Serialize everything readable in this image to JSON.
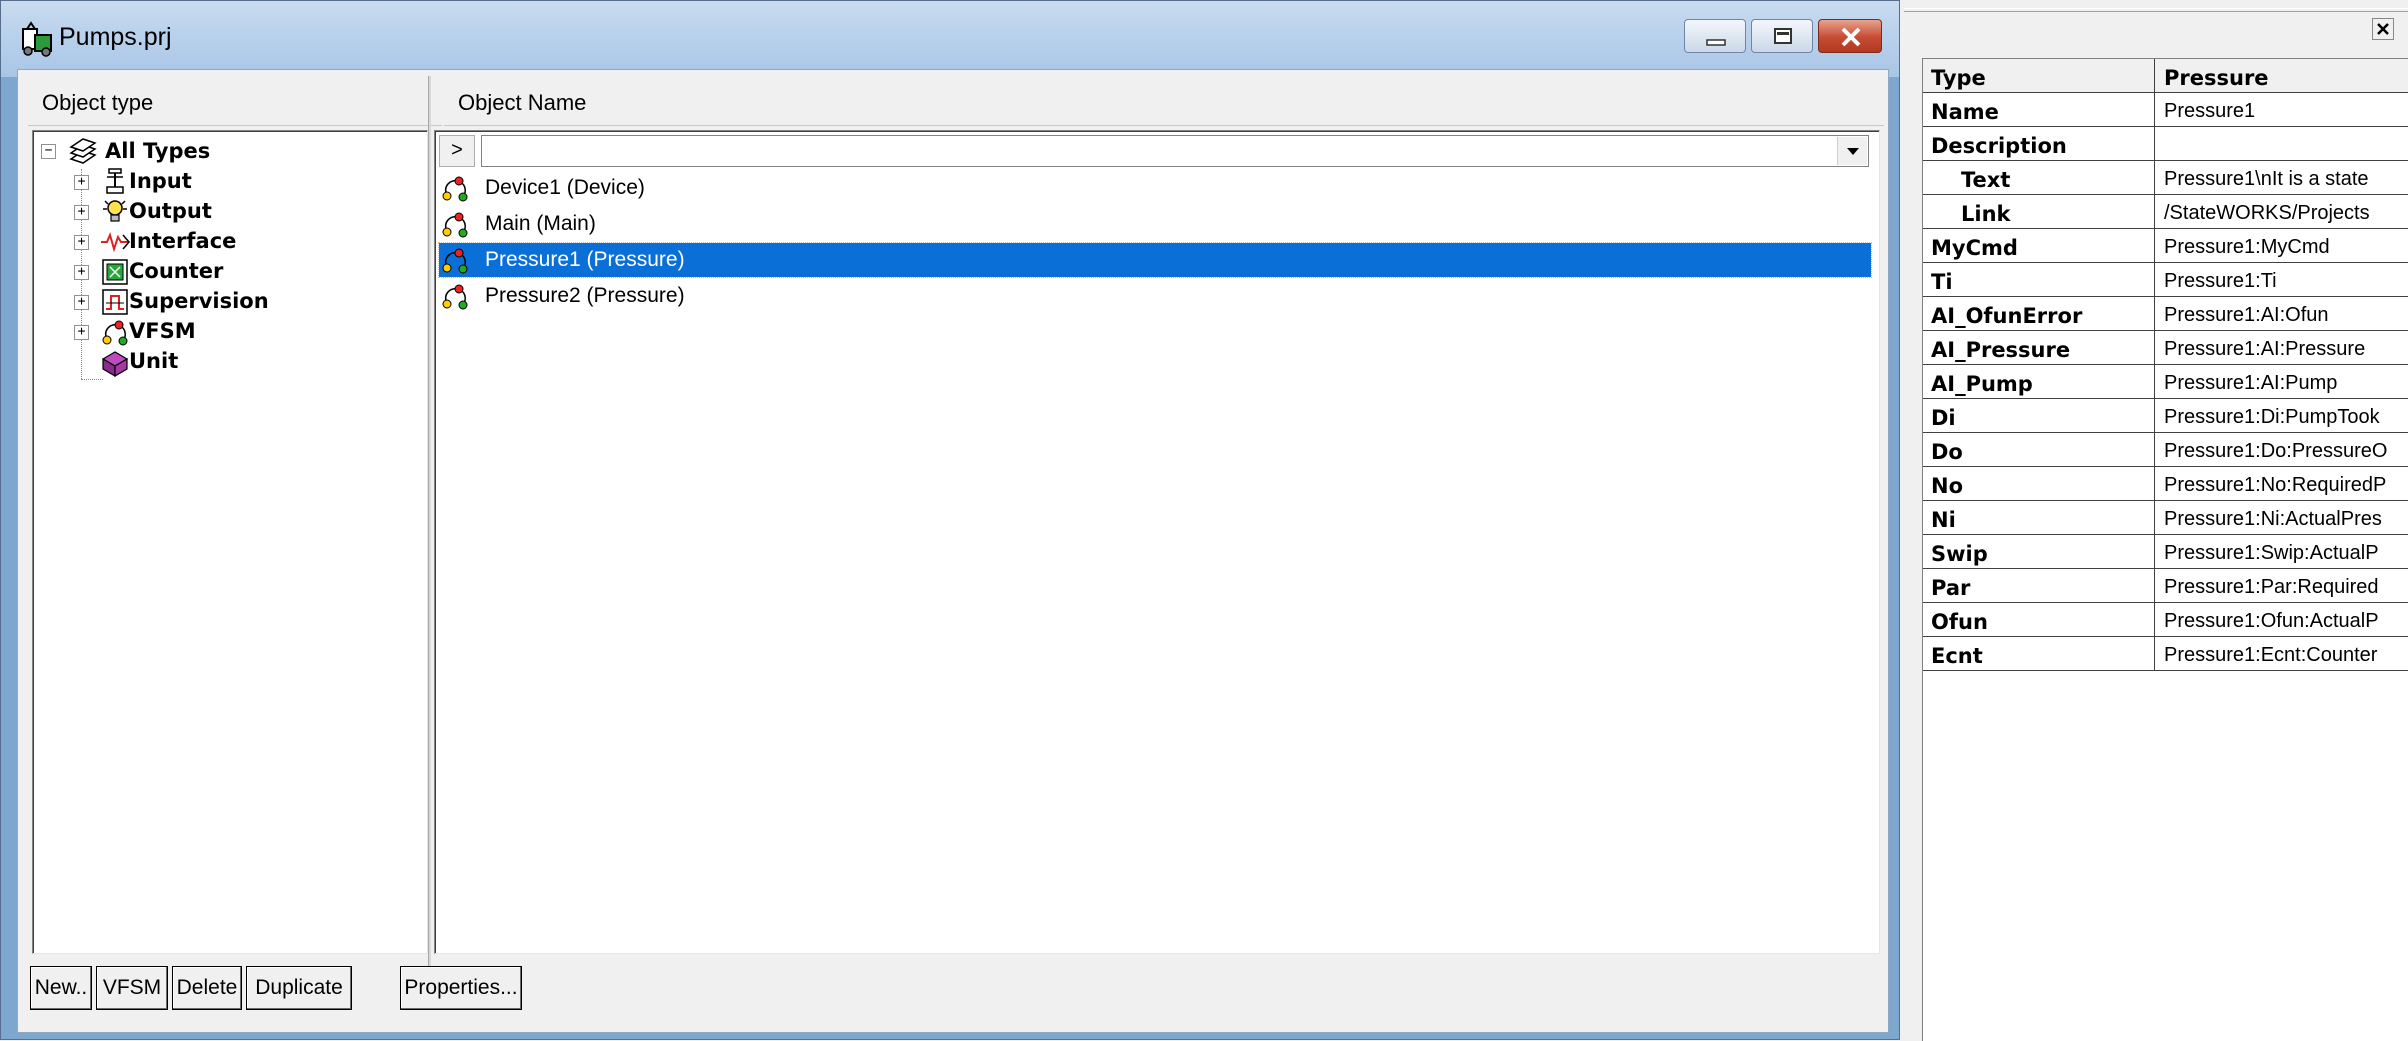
{
  "window": {
    "title": "Pumps.prj"
  },
  "headers": {
    "object_type": "Object type",
    "object_name": "Object Name"
  },
  "tree": [
    {
      "label": "All Types",
      "icon": "all-types-icon",
      "expander": "minus"
    },
    {
      "label": "Input",
      "icon": "input-icon",
      "expander": "plus"
    },
    {
      "label": "Output",
      "icon": "output-bulb-icon",
      "expander": "plus"
    },
    {
      "label": "Interface",
      "icon": "interface-icon",
      "expander": "plus"
    },
    {
      "label": "Counter",
      "icon": "counter-icon",
      "expander": "plus"
    },
    {
      "label": "Supervision",
      "icon": "supervision-icon",
      "expander": "plus"
    },
    {
      "label": "VFSM",
      "icon": "vfsm-icon",
      "expander": "plus"
    },
    {
      "label": "Unit",
      "icon": "unit-icon",
      "expander": "none"
    }
  ],
  "filter": {
    "go_label": ">",
    "value": ""
  },
  "objects": [
    {
      "label": "Device1 (Device)",
      "selected": false
    },
    {
      "label": "Main (Main)",
      "selected": false
    },
    {
      "label": "Pressure1 (Pressure)",
      "selected": true
    },
    {
      "label": "Pressure2 (Pressure)",
      "selected": false
    }
  ],
  "buttons": {
    "new": "New..",
    "vfsm": "VFSM",
    "delete": "Delete",
    "duplicate": "Duplicate",
    "properties": "Properties..."
  },
  "properties": {
    "close_glyph": "×",
    "header": {
      "key": "Type",
      "value": "Pressure"
    },
    "rows": [
      {
        "key": "Name",
        "value": "Pressure1",
        "indent": false
      },
      {
        "key": "Description",
        "value": "",
        "indent": false
      },
      {
        "key": "Text",
        "value": "Pressure1\\nIt is a state",
        "indent": true
      },
      {
        "key": "Link",
        "value": "/StateWORKS/Projects",
        "indent": true
      },
      {
        "key": "MyCmd",
        "value": "Pressure1:MyCmd",
        "indent": false
      },
      {
        "key": "Ti",
        "value": "Pressure1:Ti",
        "indent": false
      },
      {
        "key": "AI_OfunError",
        "value": "Pressure1:AI:Ofun",
        "indent": false
      },
      {
        "key": "AI_Pressure",
        "value": "Pressure1:AI:Pressure",
        "indent": false
      },
      {
        "key": "AI_Pump",
        "value": "Pressure1:AI:Pump",
        "indent": false
      },
      {
        "key": "Di",
        "value": "Pressure1:Di:PumpTook",
        "indent": false
      },
      {
        "key": "Do",
        "value": "Pressure1:Do:PressureO",
        "indent": false
      },
      {
        "key": "No",
        "value": "Pressure1:No:RequiredP",
        "indent": false
      },
      {
        "key": "Ni",
        "value": "Pressure1:Ni:ActualPres",
        "indent": false
      },
      {
        "key": "Swip",
        "value": "Pressure1:Swip:ActualP",
        "indent": false
      },
      {
        "key": "Par",
        "value": "Pressure1:Par:Required",
        "indent": false
      },
      {
        "key": "Ofun",
        "value": "Pressure1:Ofun:ActualP",
        "indent": false
      },
      {
        "key": "Ecnt",
        "value": "Pressure1:Ecnt:Counter",
        "indent": false
      }
    ]
  },
  "colors": {
    "selection": "#0a6fd6",
    "title_gradient_top": "#c9dbef",
    "close_button": "#c64b32"
  }
}
